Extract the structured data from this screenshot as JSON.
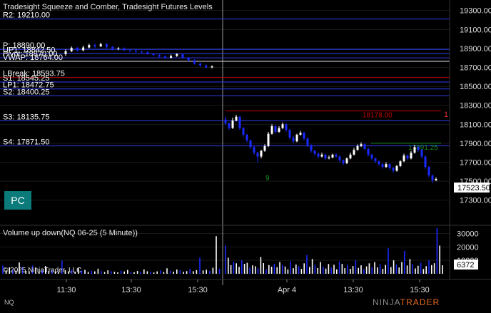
{
  "chart_data": [
    {
      "type": "candlestick",
      "title": "Tradesight Squeeze and Comber, Tradesight Futures Levels",
      "y_ticks": [
        "19300.00",
        "19100.00",
        "18900.00",
        "18700.00",
        "18500.00",
        "18300.00",
        "18100.00",
        "17900.00",
        "17700.00",
        "17500.00",
        "17300.00"
      ],
      "ylim": [
        17200,
        19350
      ],
      "last_price": "17523.50",
      "levels": [
        {
          "label": "R2: 19210.00",
          "value": 19210,
          "color": "#2c3cf0"
        },
        {
          "label": "P: 18890.00",
          "value": 18890,
          "color": "#2c3cf0"
        },
        {
          "label": "UP1: 18842.50",
          "value": 18842.5,
          "color": "#2c3cf0"
        },
        {
          "label": "Pivot: 18870.00",
          "value": 18800,
          "color": "#2c3cf0"
        },
        {
          "label": "VWAP: 18764.00",
          "value": 18764,
          "color": "#e0e0e0"
        },
        {
          "label": "LBreak: 18593.75",
          "value": 18593.75,
          "color": "#c00000"
        },
        {
          "label": "S1: 18545.25",
          "value": 18545.25,
          "color": "#2c3cf0"
        },
        {
          "label": "LP1: 18472.75",
          "value": 18472.75,
          "color": "#2c3cf0"
        },
        {
          "label": "S2: 18400.25",
          "value": 18400.25,
          "color": "#2c3cf0"
        },
        {
          "label": "S3: 18135.75",
          "value": 18135.75,
          "color": "#2c3cf0"
        },
        {
          "label": "S4: 17871.50",
          "value": 17871.5,
          "color": "#2c3cf0"
        }
      ],
      "target_lines": [
        {
          "label": "18178.00",
          "value": 18240,
          "color": "#c00000"
        },
        {
          "label": "17891.25",
          "value": 17900,
          "color": "#1a8a1a"
        }
      ],
      "target_marker": "1",
      "session_a": [
        {
          "o": 18840,
          "c": 18870,
          "h": 18890,
          "l": 18820
        },
        {
          "o": 18870,
          "c": 18905,
          "h": 18920,
          "l": 18860
        },
        {
          "o": 18905,
          "c": 18880,
          "h": 18915,
          "l": 18865
        },
        {
          "o": 18880,
          "c": 18910,
          "h": 18930,
          "l": 18870
        },
        {
          "o": 18910,
          "c": 18935,
          "h": 18950,
          "l": 18900
        },
        {
          "o": 18935,
          "c": 18920,
          "h": 18950,
          "l": 18905
        },
        {
          "o": 18920,
          "c": 18945,
          "h": 18960,
          "l": 18915
        },
        {
          "o": 18945,
          "c": 18915,
          "h": 18955,
          "l": 18900
        },
        {
          "o": 18915,
          "c": 18895,
          "h": 18925,
          "l": 18880
        },
        {
          "o": 18895,
          "c": 18900,
          "h": 18915,
          "l": 18880
        },
        {
          "o": 18900,
          "c": 18880,
          "h": 18910,
          "l": 18870
        },
        {
          "o": 18880,
          "c": 18875,
          "h": 18890,
          "l": 18860
        },
        {
          "o": 18875,
          "c": 18865,
          "h": 18885,
          "l": 18855
        },
        {
          "o": 18865,
          "c": 18860,
          "h": 18875,
          "l": 18850
        },
        {
          "o": 18860,
          "c": 18845,
          "h": 18870,
          "l": 18835
        },
        {
          "o": 18845,
          "c": 18830,
          "h": 18855,
          "l": 18820
        },
        {
          "o": 18830,
          "c": 18815,
          "h": 18840,
          "l": 18805
        },
        {
          "o": 18815,
          "c": 18800,
          "h": 18825,
          "l": 18790
        },
        {
          "o": 18800,
          "c": 18820,
          "h": 18835,
          "l": 18795
        },
        {
          "o": 18820,
          "c": 18840,
          "h": 18850,
          "l": 18810
        },
        {
          "o": 18840,
          "c": 18800,
          "h": 18845,
          "l": 18790
        },
        {
          "o": 18800,
          "c": 18775,
          "h": 18810,
          "l": 18760
        },
        {
          "o": 18775,
          "c": 18740,
          "h": 18785,
          "l": 18730
        },
        {
          "o": 18740,
          "c": 18720,
          "h": 18750,
          "l": 18705
        },
        {
          "o": 18720,
          "c": 18700,
          "h": 18730,
          "l": 18690
        },
        {
          "o": 18700,
          "c": 18710,
          "h": 18720,
          "l": 18690
        }
      ],
      "session_b": [
        {
          "o": 18150,
          "c": 18110,
          "h": 18180,
          "l": 18090
        },
        {
          "o": 18110,
          "c": 18060,
          "h": 18120,
          "l": 18040
        },
        {
          "o": 18060,
          "c": 18140,
          "h": 18170,
          "l": 18050
        },
        {
          "o": 18140,
          "c": 18180,
          "h": 18200,
          "l": 18130
        },
        {
          "o": 18180,
          "c": 18060,
          "h": 18185,
          "l": 18040
        },
        {
          "o": 18060,
          "c": 17990,
          "h": 18070,
          "l": 17970
        },
        {
          "o": 17990,
          "c": 17930,
          "h": 18000,
          "l": 17910
        },
        {
          "o": 17930,
          "c": 17860,
          "h": 17940,
          "l": 17840
        },
        {
          "o": 17860,
          "c": 17800,
          "h": 17870,
          "l": 17780
        },
        {
          "o": 17800,
          "c": 17760,
          "h": 17810,
          "l": 17700
        },
        {
          "o": 17760,
          "c": 17820,
          "h": 17830,
          "l": 17740
        },
        {
          "o": 17820,
          "c": 17870,
          "h": 17890,
          "l": 17810
        },
        {
          "o": 17870,
          "c": 18000,
          "h": 18020,
          "l": 17860
        },
        {
          "o": 18000,
          "c": 18080,
          "h": 18100,
          "l": 17990
        },
        {
          "o": 18080,
          "c": 18020,
          "h": 18090,
          "l": 18000
        },
        {
          "o": 18020,
          "c": 18060,
          "h": 18080,
          "l": 18010
        },
        {
          "o": 18060,
          "c": 18100,
          "h": 18120,
          "l": 18050
        },
        {
          "o": 18100,
          "c": 18040,
          "h": 18110,
          "l": 18020
        },
        {
          "o": 18040,
          "c": 17960,
          "h": 18050,
          "l": 17940
        },
        {
          "o": 17960,
          "c": 17920,
          "h": 17980,
          "l": 17900
        },
        {
          "o": 17920,
          "c": 17990,
          "h": 18000,
          "l": 17910
        },
        {
          "o": 17990,
          "c": 18010,
          "h": 18030,
          "l": 17980
        },
        {
          "o": 18010,
          "c": 17950,
          "h": 18020,
          "l": 17930
        },
        {
          "o": 17950,
          "c": 17880,
          "h": 17960,
          "l": 17860
        },
        {
          "o": 17880,
          "c": 17820,
          "h": 17890,
          "l": 17800
        },
        {
          "o": 17820,
          "c": 17790,
          "h": 17830,
          "l": 17770
        },
        {
          "o": 17790,
          "c": 17760,
          "h": 17800,
          "l": 17740
        },
        {
          "o": 17760,
          "c": 17780,
          "h": 17800,
          "l": 17750
        },
        {
          "o": 17780,
          "c": 17740,
          "h": 17790,
          "l": 17720
        },
        {
          "o": 17740,
          "c": 17750,
          "h": 17770,
          "l": 17730
        },
        {
          "o": 17750,
          "c": 17780,
          "h": 17790,
          "l": 17740
        },
        {
          "o": 17780,
          "c": 17760,
          "h": 17795,
          "l": 17745
        },
        {
          "o": 17760,
          "c": 17720,
          "h": 17770,
          "l": 17700
        },
        {
          "o": 17720,
          "c": 17690,
          "h": 17730,
          "l": 17670
        },
        {
          "o": 17690,
          "c": 17740,
          "h": 17750,
          "l": 17680
        },
        {
          "o": 17740,
          "c": 17780,
          "h": 17800,
          "l": 17730
        },
        {
          "o": 17780,
          "c": 17830,
          "h": 17850,
          "l": 17770
        },
        {
          "o": 17830,
          "c": 17870,
          "h": 17890,
          "l": 17820
        },
        {
          "o": 17870,
          "c": 17890,
          "h": 17910,
          "l": 17860
        },
        {
          "o": 17890,
          "c": 17840,
          "h": 17900,
          "l": 17830
        },
        {
          "o": 17840,
          "c": 17780,
          "h": 17850,
          "l": 17760
        },
        {
          "o": 17780,
          "c": 17740,
          "h": 17790,
          "l": 17720
        },
        {
          "o": 17740,
          "c": 17710,
          "h": 17750,
          "l": 17690
        },
        {
          "o": 17710,
          "c": 17680,
          "h": 17720,
          "l": 17660
        },
        {
          "o": 17680,
          "c": 17650,
          "h": 17690,
          "l": 17630
        },
        {
          "o": 17650,
          "c": 17680,
          "h": 17700,
          "l": 17640
        },
        {
          "o": 17680,
          "c": 17640,
          "h": 17690,
          "l": 17620
        },
        {
          "o": 17640,
          "c": 17610,
          "h": 17650,
          "l": 17590
        },
        {
          "o": 17610,
          "c": 17660,
          "h": 17670,
          "l": 17600
        },
        {
          "o": 17660,
          "c": 17710,
          "h": 17720,
          "l": 17650
        },
        {
          "o": 17710,
          "c": 17770,
          "h": 17790,
          "l": 17700
        },
        {
          "o": 17770,
          "c": 17740,
          "h": 17780,
          "l": 17720
        },
        {
          "o": 17740,
          "c": 17800,
          "h": 17820,
          "l": 17730
        },
        {
          "o": 17800,
          "c": 17860,
          "h": 17880,
          "l": 17790
        },
        {
          "o": 17860,
          "c": 17830,
          "h": 17870,
          "l": 17810
        },
        {
          "o": 17830,
          "c": 17760,
          "h": 17840,
          "l": 17740
        },
        {
          "o": 17760,
          "c": 17650,
          "h": 17770,
          "l": 17630
        },
        {
          "o": 17650,
          "c": 17560,
          "h": 17660,
          "l": 17540
        },
        {
          "o": 17560,
          "c": 17510,
          "h": 17570,
          "l": 17480
        },
        {
          "o": 17510,
          "c": 17523.5,
          "h": 17540,
          "l": 17500
        }
      ]
    },
    {
      "type": "bar",
      "title": "Volume up down(NQ 06-25 (5 Minute))",
      "y_ticks": [
        "30000",
        "20000",
        "10000"
      ],
      "ylim": [
        0,
        34000
      ],
      "last_value": "6372",
      "volumes_a": [
        6200,
        2600,
        4800,
        3200,
        2300,
        8500,
        5400,
        2100,
        1900,
        6100,
        4700,
        1500,
        2900,
        5800,
        2100,
        2800,
        1700,
        1200,
        9800,
        2700,
        1800,
        3100,
        1600,
        4200,
        2500,
        2900,
        1400,
        2200,
        1800,
        3800,
        2000,
        1300,
        2600,
        1900,
        1500,
        1100,
        2300,
        1700,
        2900,
        1400,
        1200,
        2100,
        1600,
        3300,
        1900,
        1500,
        1000,
        1800,
        2500,
        1300,
        4100,
        2200,
        1600,
        3200,
        2700,
        1400,
        2000,
        3600,
        1900,
        2700,
        12000,
        2500,
        3000,
        2200,
        4500,
        28000,
        3800
      ],
      "volumes_b": [
        21000,
        12000,
        6500,
        9000,
        7800,
        5200,
        10000,
        7400,
        8200,
        4700,
        6300,
        5600,
        4100,
        12500,
        8000,
        3400,
        6500,
        5300,
        7400,
        4900,
        8800,
        6500,
        5400,
        3300,
        9300,
        4200,
        6900,
        5700,
        3600,
        7800,
        14000,
        5100,
        11000,
        6700,
        4300,
        8800,
        5400,
        3900,
        7300,
        4600,
        6700,
        3300,
        9100,
        7400,
        4200,
        6600,
        3700,
        5800,
        10000,
        4400,
        6300,
        3500,
        5500,
        7800,
        4900,
        8700,
        4800,
        7200,
        3700,
        6600,
        19000,
        5000,
        10000,
        6800,
        4700,
        8800,
        17000,
        6200,
        11000,
        7300,
        4000,
        6000,
        8300,
        3600,
        5700,
        10000,
        6500,
        7900,
        34000,
        21000,
        6372
      ]
    }
  ],
  "x_labels": [
    "11:30",
    "13:30",
    "15:30",
    "Apr 4",
    "13:30",
    "15:30"
  ],
  "copyright": "© 2025 NinjaTrader, LLC",
  "instrument": "NQ",
  "pc_button": "PC",
  "logo_text": "NINJA",
  "logo_brand": "TRADER",
  "squeeze_label_a": "9",
  "squeeze_label_b": "9",
  "colors": {
    "up": "#ffffff",
    "down": "#1a2aff",
    "grid": "#1a1a1a",
    "axis_text": "#dcdcdc"
  }
}
